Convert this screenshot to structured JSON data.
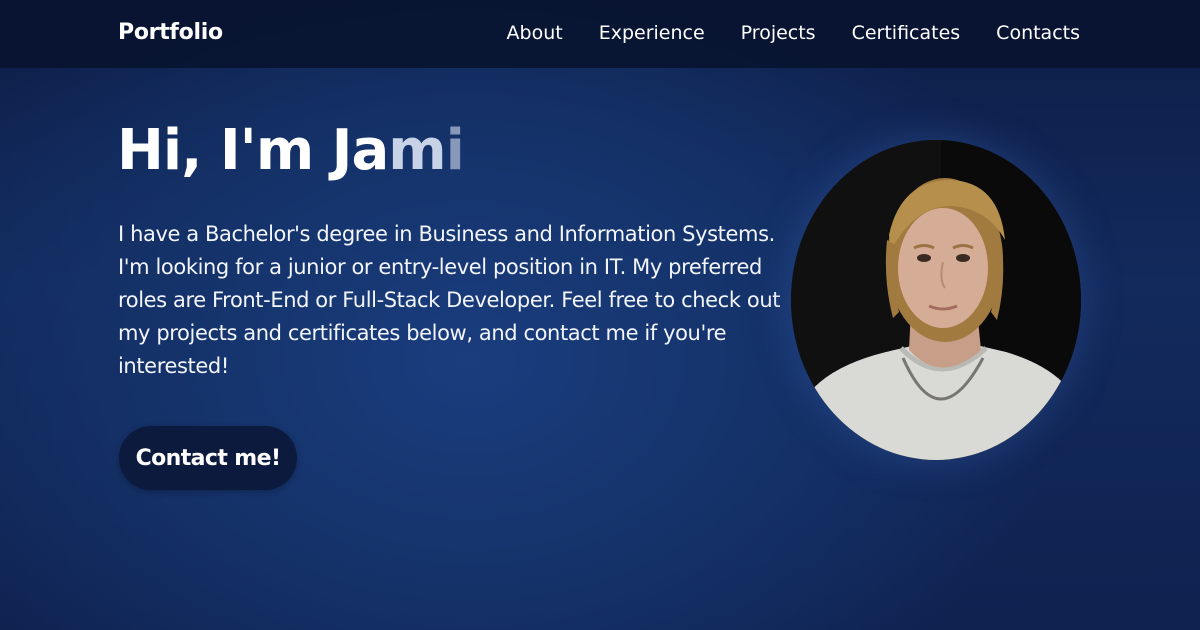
{
  "header": {
    "brand": "Portfolio",
    "nav": [
      {
        "label": "About"
      },
      {
        "label": "Experience"
      },
      {
        "label": "Projects"
      },
      {
        "label": "Certificates"
      },
      {
        "label": "Contacts"
      }
    ]
  },
  "hero": {
    "title_parts": [
      "Hi, I'm Ja",
      "m",
      "i"
    ],
    "description": "I have a Bachelor's degree in Business and Information Systems. I'm looking for a junior or entry-level position in IT. My preferred roles are Front-End or Full-Stack Developer. Feel free to check out my projects and certificates below, and contact me if you're interested!",
    "cta_label": "Contact me!"
  }
}
